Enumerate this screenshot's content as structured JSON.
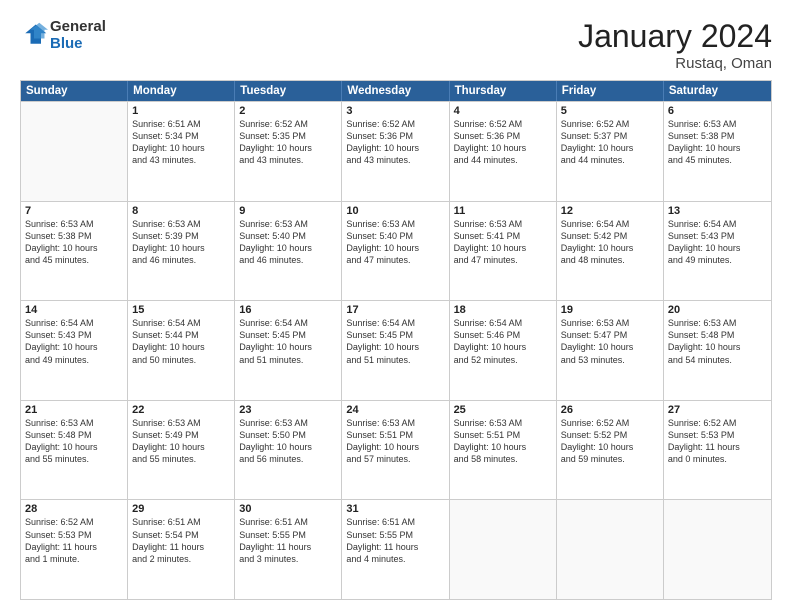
{
  "logo": {
    "line1": "General",
    "line2": "Blue"
  },
  "title": "January 2024",
  "subtitle": "Rustaq, Oman",
  "header_days": [
    "Sunday",
    "Monday",
    "Tuesday",
    "Wednesday",
    "Thursday",
    "Friday",
    "Saturday"
  ],
  "weeks": [
    [
      {
        "day": "",
        "info": ""
      },
      {
        "day": "1",
        "info": "Sunrise: 6:51 AM\nSunset: 5:34 PM\nDaylight: 10 hours\nand 43 minutes."
      },
      {
        "day": "2",
        "info": "Sunrise: 6:52 AM\nSunset: 5:35 PM\nDaylight: 10 hours\nand 43 minutes."
      },
      {
        "day": "3",
        "info": "Sunrise: 6:52 AM\nSunset: 5:36 PM\nDaylight: 10 hours\nand 43 minutes."
      },
      {
        "day": "4",
        "info": "Sunrise: 6:52 AM\nSunset: 5:36 PM\nDaylight: 10 hours\nand 44 minutes."
      },
      {
        "day": "5",
        "info": "Sunrise: 6:52 AM\nSunset: 5:37 PM\nDaylight: 10 hours\nand 44 minutes."
      },
      {
        "day": "6",
        "info": "Sunrise: 6:53 AM\nSunset: 5:38 PM\nDaylight: 10 hours\nand 45 minutes."
      }
    ],
    [
      {
        "day": "7",
        "info": "Sunrise: 6:53 AM\nSunset: 5:38 PM\nDaylight: 10 hours\nand 45 minutes."
      },
      {
        "day": "8",
        "info": "Sunrise: 6:53 AM\nSunset: 5:39 PM\nDaylight: 10 hours\nand 46 minutes."
      },
      {
        "day": "9",
        "info": "Sunrise: 6:53 AM\nSunset: 5:40 PM\nDaylight: 10 hours\nand 46 minutes."
      },
      {
        "day": "10",
        "info": "Sunrise: 6:53 AM\nSunset: 5:40 PM\nDaylight: 10 hours\nand 47 minutes."
      },
      {
        "day": "11",
        "info": "Sunrise: 6:53 AM\nSunset: 5:41 PM\nDaylight: 10 hours\nand 47 minutes."
      },
      {
        "day": "12",
        "info": "Sunrise: 6:54 AM\nSunset: 5:42 PM\nDaylight: 10 hours\nand 48 minutes."
      },
      {
        "day": "13",
        "info": "Sunrise: 6:54 AM\nSunset: 5:43 PM\nDaylight: 10 hours\nand 49 minutes."
      }
    ],
    [
      {
        "day": "14",
        "info": "Sunrise: 6:54 AM\nSunset: 5:43 PM\nDaylight: 10 hours\nand 49 minutes."
      },
      {
        "day": "15",
        "info": "Sunrise: 6:54 AM\nSunset: 5:44 PM\nDaylight: 10 hours\nand 50 minutes."
      },
      {
        "day": "16",
        "info": "Sunrise: 6:54 AM\nSunset: 5:45 PM\nDaylight: 10 hours\nand 51 minutes."
      },
      {
        "day": "17",
        "info": "Sunrise: 6:54 AM\nSunset: 5:45 PM\nDaylight: 10 hours\nand 51 minutes."
      },
      {
        "day": "18",
        "info": "Sunrise: 6:54 AM\nSunset: 5:46 PM\nDaylight: 10 hours\nand 52 minutes."
      },
      {
        "day": "19",
        "info": "Sunrise: 6:53 AM\nSunset: 5:47 PM\nDaylight: 10 hours\nand 53 minutes."
      },
      {
        "day": "20",
        "info": "Sunrise: 6:53 AM\nSunset: 5:48 PM\nDaylight: 10 hours\nand 54 minutes."
      }
    ],
    [
      {
        "day": "21",
        "info": "Sunrise: 6:53 AM\nSunset: 5:48 PM\nDaylight: 10 hours\nand 55 minutes."
      },
      {
        "day": "22",
        "info": "Sunrise: 6:53 AM\nSunset: 5:49 PM\nDaylight: 10 hours\nand 55 minutes."
      },
      {
        "day": "23",
        "info": "Sunrise: 6:53 AM\nSunset: 5:50 PM\nDaylight: 10 hours\nand 56 minutes."
      },
      {
        "day": "24",
        "info": "Sunrise: 6:53 AM\nSunset: 5:51 PM\nDaylight: 10 hours\nand 57 minutes."
      },
      {
        "day": "25",
        "info": "Sunrise: 6:53 AM\nSunset: 5:51 PM\nDaylight: 10 hours\nand 58 minutes."
      },
      {
        "day": "26",
        "info": "Sunrise: 6:52 AM\nSunset: 5:52 PM\nDaylight: 10 hours\nand 59 minutes."
      },
      {
        "day": "27",
        "info": "Sunrise: 6:52 AM\nSunset: 5:53 PM\nDaylight: 11 hours\nand 0 minutes."
      }
    ],
    [
      {
        "day": "28",
        "info": "Sunrise: 6:52 AM\nSunset: 5:53 PM\nDaylight: 11 hours\nand 1 minute."
      },
      {
        "day": "29",
        "info": "Sunrise: 6:51 AM\nSunset: 5:54 PM\nDaylight: 11 hours\nand 2 minutes."
      },
      {
        "day": "30",
        "info": "Sunrise: 6:51 AM\nSunset: 5:55 PM\nDaylight: 11 hours\nand 3 minutes."
      },
      {
        "day": "31",
        "info": "Sunrise: 6:51 AM\nSunset: 5:55 PM\nDaylight: 11 hours\nand 4 minutes."
      },
      {
        "day": "",
        "info": ""
      },
      {
        "day": "",
        "info": ""
      },
      {
        "day": "",
        "info": ""
      }
    ]
  ]
}
